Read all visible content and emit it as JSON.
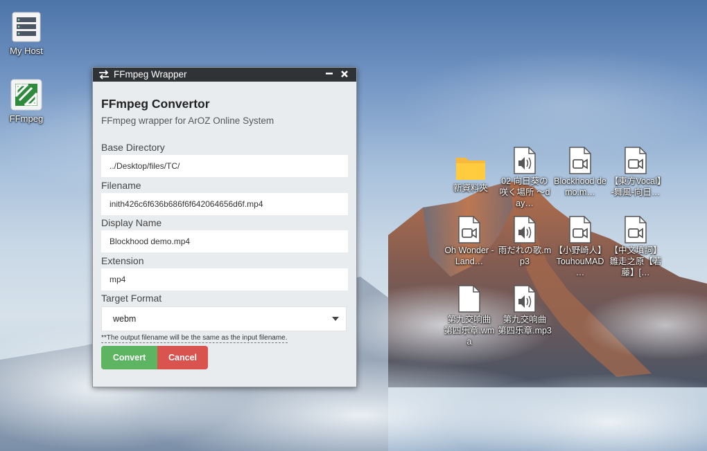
{
  "desktop": {
    "shortcuts": [
      {
        "label": "My Host",
        "icon": "server-icon"
      },
      {
        "label": "FFmpeg",
        "icon": "ffmpeg-icon"
      }
    ],
    "files": [
      {
        "label": "新資料夾",
        "icon": "folder-icon"
      },
      {
        "label": "02 向日葵の咲く場所 ～day…",
        "icon": "audio-file-icon"
      },
      {
        "label": "Blockhood demo.m…",
        "icon": "video-file-icon"
      },
      {
        "label": "【東方Vocal】-舞風-向日…",
        "icon": "video-file-icon"
      },
      {
        "label": "Oh Wonder - Land…",
        "icon": "video-file-icon"
      },
      {
        "label": "雨だれの歌.mp3",
        "icon": "audio-file-icon"
      },
      {
        "label": "【小野崎人】TouhouMAD …",
        "icon": "video-file-icon"
      },
      {
        "label": "【中文填詞】雛走之原【若藤】[…",
        "icon": "video-file-icon"
      },
      {
        "label": "第九交响曲 第四乐章.wma",
        "icon": "file-icon"
      },
      {
        "label": "第九交响曲 第四乐章.mp3",
        "icon": "audio-file-icon"
      }
    ]
  },
  "window": {
    "title": "FFmpeg Wrapper",
    "heading": "FFmpeg Convertor",
    "subheading": "FFmpeg wrapper for ArOZ Online System",
    "fields": {
      "base_directory": {
        "label": "Base Directory",
        "value": "../Desktop/files/TC/"
      },
      "filename": {
        "label": "Filename",
        "value": "inith426c6f636b686f6f642064656d6f.mp4"
      },
      "display_name": {
        "label": "Display Name",
        "value": "Blockhood demo.mp4"
      },
      "extension": {
        "label": "Extension",
        "value": "mp4"
      },
      "target_format": {
        "label": "Target Format",
        "value": "webm"
      }
    },
    "note": "**The output filename will be the same as the input filename.",
    "buttons": {
      "convert": "Convert",
      "cancel": "Cancel"
    },
    "colors": {
      "titlebar": "#303336",
      "convert": "#5db461",
      "cancel": "#d9534f"
    }
  }
}
